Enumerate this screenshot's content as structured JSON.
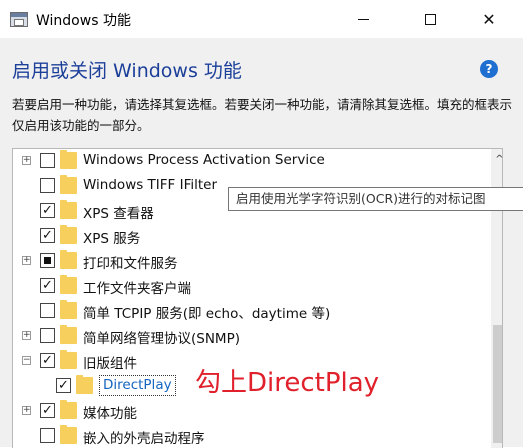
{
  "window": {
    "title": "Windows 功能"
  },
  "controls": {
    "minimize": "minimize-icon",
    "maximize": "maximize-icon",
    "close_glyph": "✕"
  },
  "heading": "启用或关闭 Windows 功能",
  "help": "?",
  "description": "若要启用一种功能，请选择其复选框。若要关闭一种功能，请清除其复选框。填充的框表示仅启用该功能的一部分。",
  "features": [
    {
      "label": "Windows Process Activation Service",
      "state": "unchecked",
      "expander": "+"
    },
    {
      "label": "Windows TIFF IFilter",
      "state": "unchecked",
      "expander": ""
    },
    {
      "label": "XPS 查看器",
      "state": "checked",
      "expander": ""
    },
    {
      "label": "XPS 服务",
      "state": "checked",
      "expander": ""
    },
    {
      "label": "打印和文件服务",
      "state": "partial",
      "expander": "+"
    },
    {
      "label": "工作文件夹客户端",
      "state": "checked",
      "expander": ""
    },
    {
      "label": "简单 TCPIP 服务(即 echo、daytime 等)",
      "state": "unchecked",
      "expander": ""
    },
    {
      "label": "简单网络管理协议(SNMP)",
      "state": "unchecked",
      "expander": "+"
    },
    {
      "label": "旧版组件",
      "state": "checked",
      "expander": "−"
    },
    {
      "label": "DirectPlay",
      "state": "checked",
      "expander": "",
      "indent": 1,
      "selected": true
    },
    {
      "label": "媒体功能",
      "state": "checked",
      "expander": "+"
    },
    {
      "label": "嵌入的外壳启动程序",
      "state": "unchecked",
      "expander": ""
    }
  ],
  "tooltip": "启用使用光学字符识别(OCR)进行的对标记图",
  "annotation": "勾上DirectPlay",
  "scroll_up_glyph": "^"
}
